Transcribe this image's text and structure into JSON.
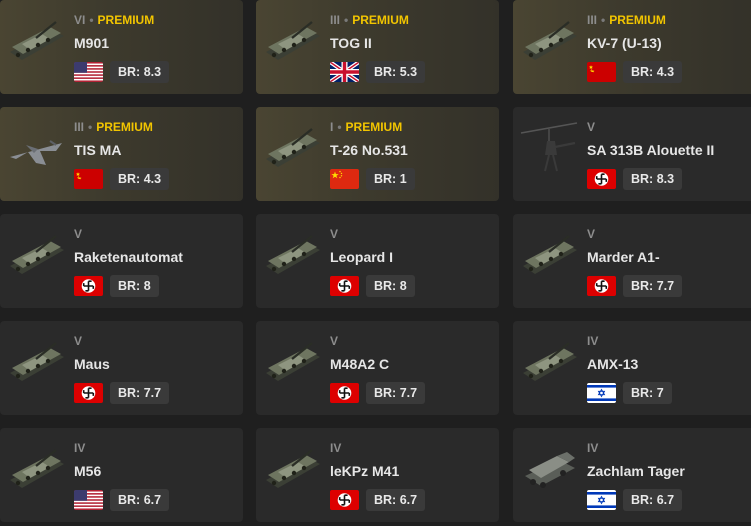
{
  "premium_label": "PREMIUM",
  "vehicles": [
    {
      "rank": "VI",
      "premium": true,
      "name": "M901",
      "nation": "usa",
      "br": "BR: 8.3",
      "icon": "tank-icon"
    },
    {
      "rank": "III",
      "premium": true,
      "name": "TOG II",
      "nation": "uk",
      "br": "BR: 5.3",
      "icon": "tank-icon"
    },
    {
      "rank": "III",
      "premium": true,
      "name": "KV-7 (U-13)",
      "nation": "ussr",
      "br": "BR: 4.3",
      "icon": "tank-icon"
    },
    {
      "rank": "III",
      "premium": true,
      "name": "TIS MA",
      "nation": "ussr",
      "br": "BR: 4.3",
      "icon": "jet-icon"
    },
    {
      "rank": "I",
      "premium": true,
      "name": "T-26 No.531",
      "nation": "china",
      "br": "BR: 1",
      "icon": "tank-icon"
    },
    {
      "rank": "V",
      "premium": false,
      "name": "SA 313B Alouette II",
      "nation": "germany",
      "br": "BR: 8.3",
      "icon": "helicopter-icon"
    },
    {
      "rank": "V",
      "premium": false,
      "name": "Raketenautomat",
      "nation": "germany",
      "br": "BR: 8",
      "icon": "tank-icon"
    },
    {
      "rank": "V",
      "premium": false,
      "name": "Leopard I",
      "nation": "germany",
      "br": "BR: 8",
      "icon": "tank-icon"
    },
    {
      "rank": "V",
      "premium": false,
      "name": "Marder A1-",
      "nation": "germany",
      "br": "BR: 7.7",
      "icon": "tank-icon"
    },
    {
      "rank": "V",
      "premium": false,
      "name": "Maus",
      "nation": "germany",
      "br": "BR: 7.7",
      "icon": "tank-icon"
    },
    {
      "rank": "V",
      "premium": false,
      "name": "M48A2 C",
      "nation": "germany",
      "br": "BR: 7.7",
      "icon": "tank-icon"
    },
    {
      "rank": "IV",
      "premium": false,
      "name": "AMX-13",
      "nation": "israel",
      "br": "BR: 7",
      "icon": "tank-icon"
    },
    {
      "rank": "IV",
      "premium": false,
      "name": "M56",
      "nation": "usa",
      "br": "BR: 6.7",
      "icon": "tank-icon"
    },
    {
      "rank": "IV",
      "premium": false,
      "name": "leKPz M41",
      "nation": "germany",
      "br": "BR: 6.7",
      "icon": "tank-icon"
    },
    {
      "rank": "IV",
      "premium": false,
      "name": "Zachlam Tager",
      "nation": "israel",
      "br": "BR: 6.7",
      "icon": "truck-icon"
    }
  ],
  "colors": {
    "premium": "#f2c500",
    "card": "#2a2a2a",
    "background": "#1f1f1f"
  }
}
